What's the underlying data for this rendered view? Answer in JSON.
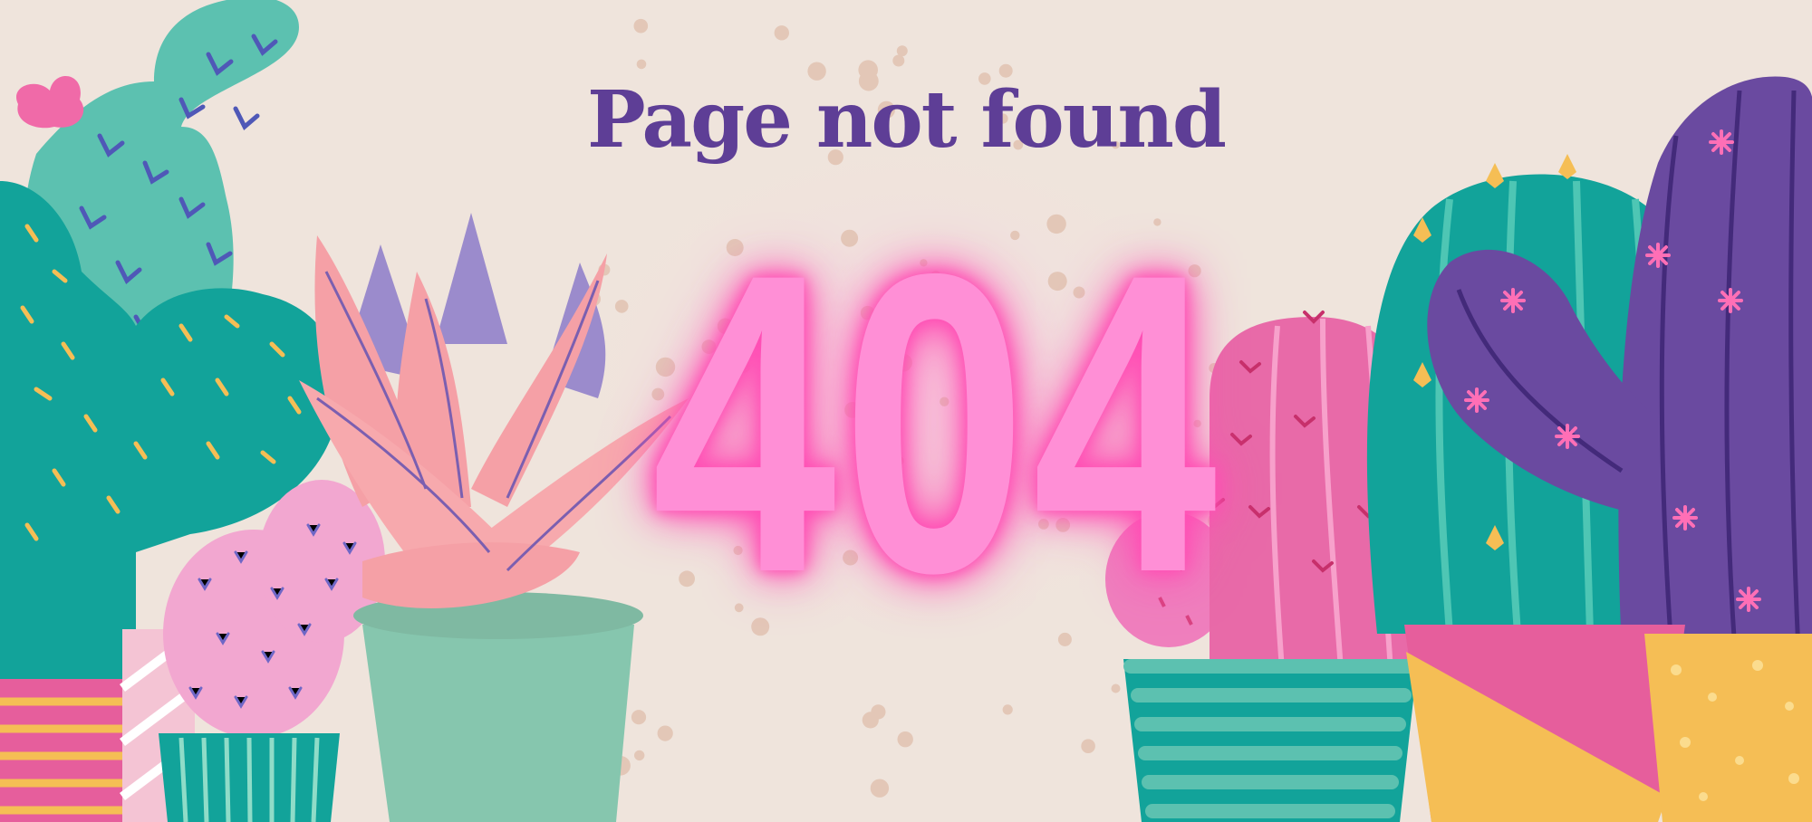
{
  "page": {
    "title": "Page not found",
    "error_code": "404"
  },
  "colors": {
    "background": "#efe4dc",
    "title": "#5e3e96",
    "code_fill": "#ff8fd6",
    "code_glow": "#ff4fb5",
    "teal": "#12a39a",
    "mint": "#5cc1b0",
    "pink": "#e86aa8",
    "light_pink": "#f5a0a6",
    "purple": "#6a4aa0",
    "yellow": "#f5be55",
    "pot_green": "#86c6ae",
    "dot": "#e3c7b7"
  },
  "icons": {
    "left_group": "cactus-group-left-icon",
    "aloe": "aloe-plant-icon",
    "right_group": "cactus-group-right-icon"
  }
}
